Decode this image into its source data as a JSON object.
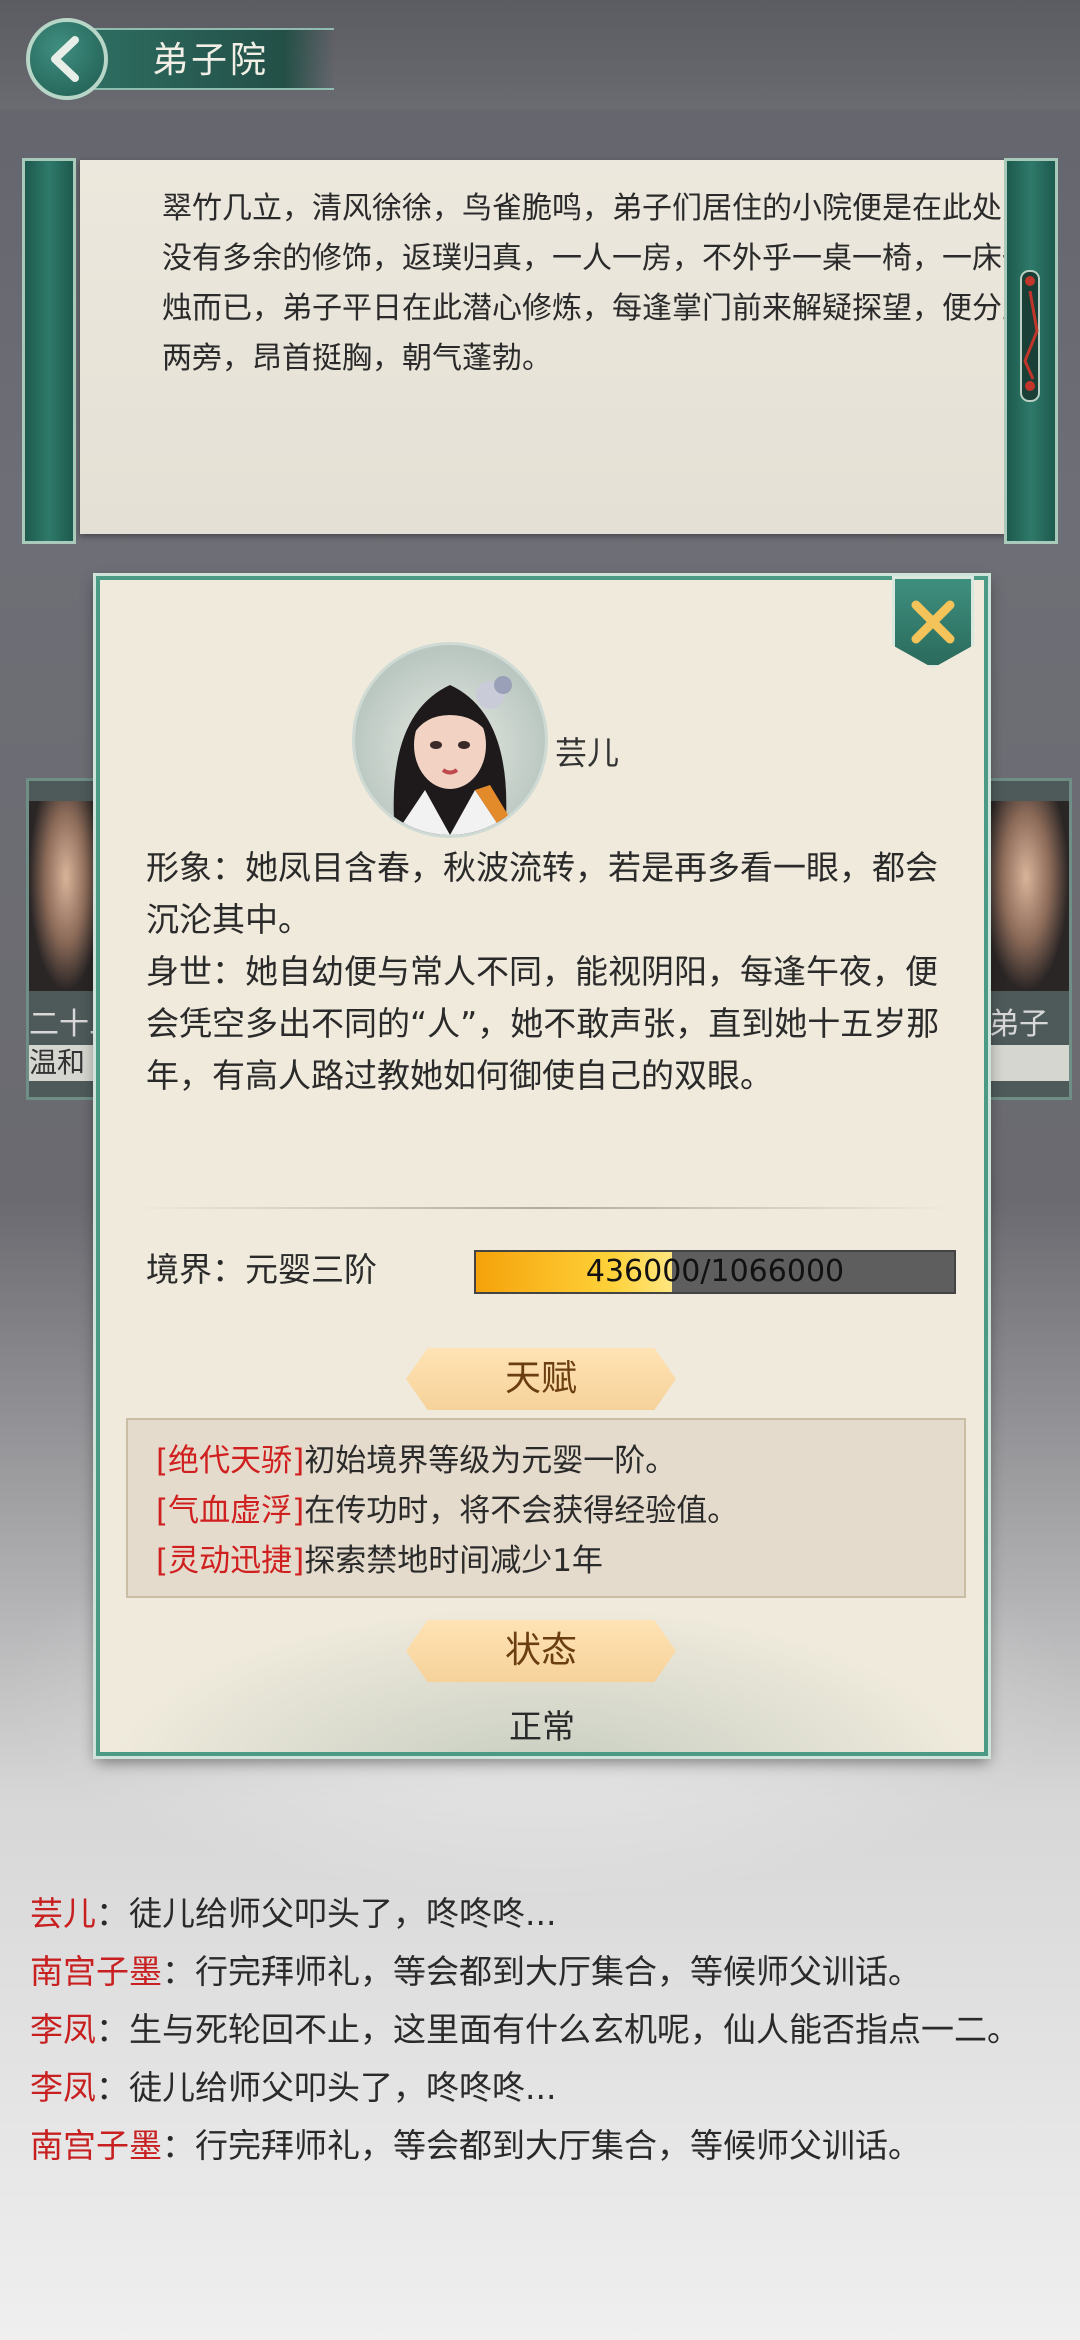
{
  "header": {
    "title": "弟子院"
  },
  "description": "翠竹几立，清风徐徐，鸟雀脆鸣，弟子们居住的小院便是在此处，没有多余的修饰，返璞归真，一人一房，不外乎一桌一椅，一床一烛而已，弟子平日在此潜心修炼，每逢掌门前来解疑探望，便分立两旁，昂首挺胸，朝气蓬勃。",
  "side_cards": {
    "left": {
      "label": "二十二",
      "tag": "温和"
    },
    "right": {
      "label": "弟子"
    }
  },
  "disciple": {
    "name": "芸儿",
    "appearance": "形象：她凤目含春，秋波流转，若是再多看一眼，都会沉沦其中。",
    "background": "身世：她自幼便与常人不同，能视阴阳，每逢午夜，便会凭空多出不同的“人”，她不敢声张，直到她十五岁那年，有高人路过教她如何御使自己的双眼。",
    "realm_label": "境界：元婴三阶",
    "progress": {
      "text": "436000/1066000",
      "fraction": 0.409
    },
    "talent_title": "天赋",
    "talents": [
      {
        "name": "[绝代天骄]",
        "desc": "初始境界等级为元婴一阶。"
      },
      {
        "name": "[气血虚浮]",
        "desc": "在传功时，将不会获得经验值。"
      },
      {
        "name": "[灵动迅捷]",
        "desc": "探索禁地时间减少1年"
      }
    ],
    "status_title": "状态",
    "status": "正常"
  },
  "chat": [
    {
      "who": "芸儿",
      "text": "：徒儿给师父叩头了，咚咚咚..."
    },
    {
      "who": "南宫子墨",
      "text": "：行完拜师礼，等会都到大厅集合，等候师父训话。"
    },
    {
      "who": "李凤",
      "text": "：生与死轮回不止，这里面有什么玄机呢，仙人能否指点一二。"
    },
    {
      "who": "李凤",
      "text": "：徒儿给师父叩头了，咚咚咚..."
    },
    {
      "who": "南宫子墨",
      "text": "：行完拜师礼，等会都到大厅集合，等候师父训话。"
    }
  ],
  "colors": {
    "accent": "#2f7a6a",
    "talent_name": "#d01f1f",
    "chat_name": "#c82020"
  }
}
